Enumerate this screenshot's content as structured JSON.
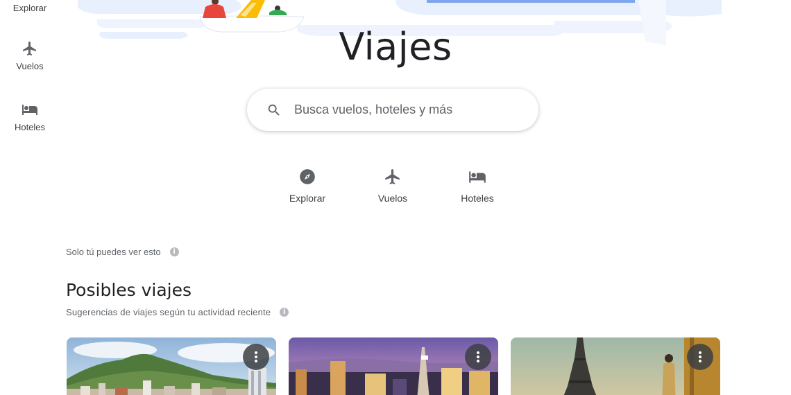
{
  "rail": {
    "items": [
      {
        "label": "Explorar",
        "icon": "explore-icon"
      },
      {
        "label": "Vuelos",
        "icon": "flight-icon"
      },
      {
        "label": "Hoteles",
        "icon": "hotel-icon"
      }
    ]
  },
  "header": {
    "title": "Viajes"
  },
  "search": {
    "placeholder": "Busca vuelos, hoteles y más",
    "icon": "search-icon"
  },
  "quick_nav": {
    "items": [
      {
        "label": "Explorar",
        "icon": "compass-icon"
      },
      {
        "label": "Vuelos",
        "icon": "flight-icon"
      },
      {
        "label": "Hoteles",
        "icon": "hotel-icon"
      }
    ]
  },
  "privacy_note": {
    "text": "Solo tú puedes ver esto",
    "icon": "info-icon"
  },
  "possible_trips": {
    "title": "Posibles viajes",
    "subtitle": "Sugerencias de viajes según tu actividad reciente",
    "cards": [
      {
        "image": "mountain-city-photo",
        "menu_icon": "more-vert-icon"
      },
      {
        "image": "las-vegas-photo",
        "menu_icon": "more-vert-icon"
      },
      {
        "image": "eiffel-tower-photo",
        "menu_icon": "more-vert-icon"
      }
    ]
  },
  "colors": {
    "text_primary": "#202124",
    "text_secondary": "#5f6368",
    "icon": "#5f6368",
    "hero_blue": "#e8f0fe"
  }
}
